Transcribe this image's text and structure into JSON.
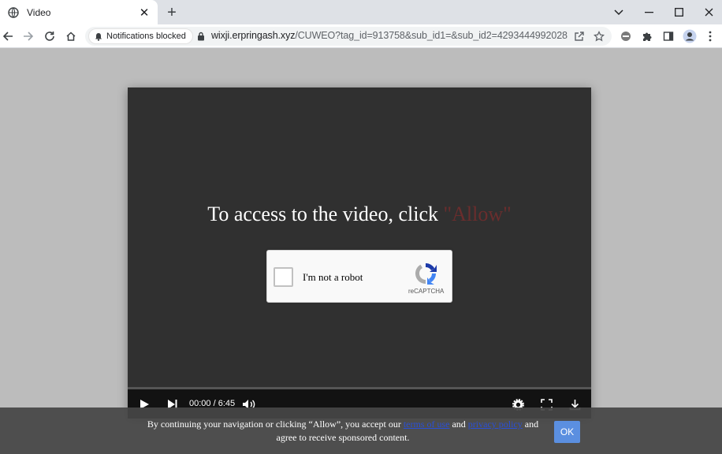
{
  "tab": {
    "title": "Video",
    "close_icon": "close-icon",
    "favicon": "globe-icon"
  },
  "toolbar": {
    "notifications_chip": "Notifications blocked",
    "url_host": "wixji.erpringash.xyz",
    "url_path": "/CUWEO?tag_id=913758&sub_id1=&sub_id2=429344499202851..."
  },
  "page": {
    "headline_text": "To access to the video, click",
    "headline_allow": "\"Allow\"",
    "captcha_label": "I'm not a robot",
    "captcha_brand": "reCAPTCHA",
    "timecode": "00:00 / 6:45",
    "progress": 0.0
  },
  "consent": {
    "text_1": "By continuing your navigation or clicking “Allow”, you accept our",
    "link_terms": "terms of use",
    "text_and": "and",
    "link_privacy": "privacy policy",
    "text_2": "and",
    "text_3": "agree to receive sponsored content.",
    "ok_label": "OK"
  },
  "colors": {
    "accent_ok": "#5b8fe0",
    "progress_red": "#d62a2a",
    "allow_red": "#6a2d2d"
  }
}
